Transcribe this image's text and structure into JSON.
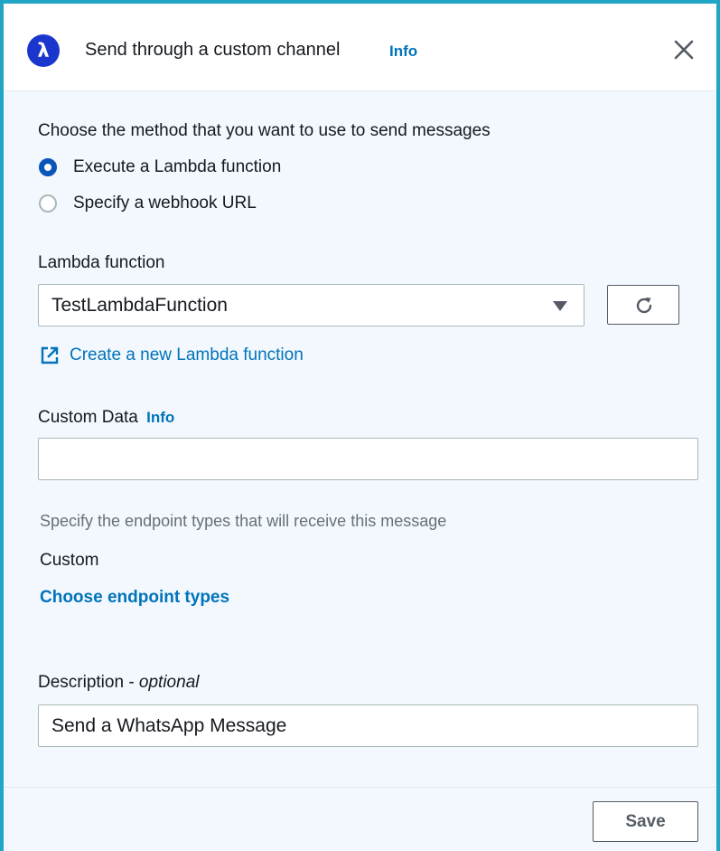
{
  "header": {
    "title": "Send through a custom channel",
    "info_label": "Info",
    "lambda_symbol": "λ",
    "close_icon": "close-icon"
  },
  "method": {
    "label": "Choose the method that you want to use to send messages",
    "options": [
      {
        "label": "Execute a Lambda function",
        "selected": true
      },
      {
        "label": "Specify a webhook URL",
        "selected": false
      }
    ]
  },
  "lambda": {
    "label": "Lambda function",
    "selected_value": "TestLambdaFunction",
    "refresh_icon": "refresh-icon",
    "create_link": "Create a new Lambda function",
    "external_icon": "external-link-icon"
  },
  "custom_data": {
    "label": "Custom Data",
    "info_label": "Info",
    "value": ""
  },
  "endpoints": {
    "hint": "Specify the endpoint types that will receive this message",
    "type_label": "Custom",
    "choose_link": "Choose endpoint types"
  },
  "description": {
    "label": "Description - ",
    "optional_label": "optional",
    "value": "Send a WhatsApp Message"
  },
  "footer": {
    "save_label": "Save"
  },
  "colors": {
    "accent_border": "#20a5c4",
    "link": "#0073bb",
    "radio_selected": "#0a55b8",
    "lambda_badge": "#1a36cc",
    "panel_background": "#f2f8fd"
  }
}
